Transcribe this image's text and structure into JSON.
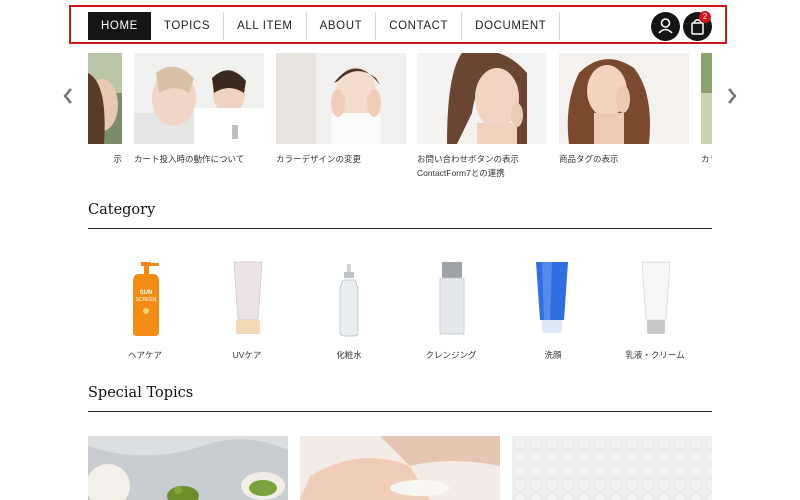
{
  "header": {
    "nav": [
      "HOME",
      "TOPICS",
      "ALL ITEM",
      "ABOUT",
      "CONTACT",
      "DOCUMENT"
    ],
    "active": "HOME",
    "cart_count": "2",
    "icons": [
      "user-icon",
      "shopping-bag-icon"
    ],
    "highlight_color": "#d0141c"
  },
  "carousel": {
    "captions": [
      {
        "line1": "示",
        "line2": ""
      },
      {
        "line1": "カート投入時の動作について",
        "line2": ""
      },
      {
        "line1": "カラーデザインの変更",
        "line2": ""
      },
      {
        "line1": "お問い合わせボタンの表示",
        "line2": "ContactForm7との連携"
      },
      {
        "line1": "商品タグの表示",
        "line2": ""
      },
      {
        "line1": "カラ",
        "line2": ""
      }
    ],
    "icons": [
      "chevron-left-icon",
      "chevron-right-icon"
    ]
  },
  "category": {
    "title": "Category",
    "items": [
      "ヘアケア",
      "UVケア",
      "化粧水",
      "クレンジング",
      "洗顔",
      "乳液・クリーム"
    ]
  },
  "special_topics": {
    "title": "Special Topics"
  }
}
